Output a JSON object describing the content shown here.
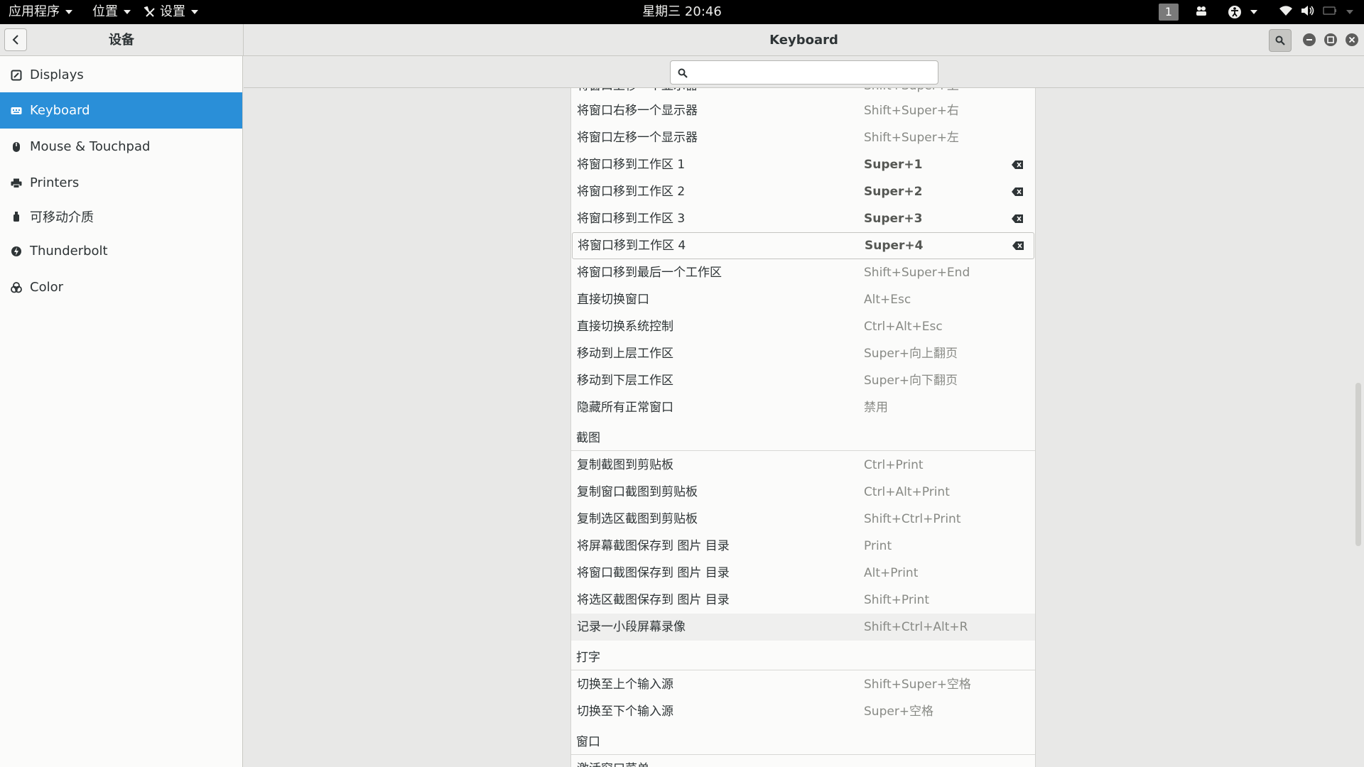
{
  "topbar": {
    "apps_label": "应用程序",
    "places_label": "位置",
    "settings_label": "设置",
    "clock": "星期三 20:46",
    "workspace": "1"
  },
  "header": {
    "sidebar_title": "设备",
    "main_title": "Keyboard"
  },
  "sidebar": {
    "items": [
      {
        "label": "Displays",
        "icon": "display-icon"
      },
      {
        "label": "Keyboard",
        "icon": "keyboard-icon",
        "active": true
      },
      {
        "label": "Mouse & Touchpad",
        "icon": "mouse-icon"
      },
      {
        "label": "Printers",
        "icon": "printer-icon"
      },
      {
        "label": "可移动介质",
        "icon": "removable-media-icon"
      },
      {
        "label": "Thunderbolt",
        "icon": "thunderbolt-icon"
      },
      {
        "label": "Color",
        "icon": "color-icon"
      }
    ]
  },
  "search": {
    "placeholder": "",
    "value": ""
  },
  "shortcuts": {
    "partial_row": {
      "name": "将窗口上移一个显示器",
      "key": "Shift+Super+上"
    },
    "window_rows": [
      {
        "name": "将窗口右移一个显示器",
        "key": "Shift+Super+右"
      },
      {
        "name": "将窗口左移一个显示器",
        "key": "Shift+Super+左"
      },
      {
        "name": "将窗口移到工作区 1",
        "key": "Super+1"
      },
      {
        "name": "将窗口移到工作区 2",
        "key": "Super+2"
      },
      {
        "name": "将窗口移到工作区 3",
        "key": "Super+3"
      },
      {
        "name": "将窗口移到工作区 4",
        "key": "Super+4"
      },
      {
        "name": "将窗口移到最后一个工作区",
        "key": "Shift+Super+End"
      },
      {
        "name": "直接切换窗口",
        "key": "Alt+Esc"
      },
      {
        "name": "直接切换系统控制",
        "key": "Ctrl+Alt+Esc"
      },
      {
        "name": "移动到上层工作区",
        "key": "Super+向上翻页"
      },
      {
        "name": "移动到下层工作区",
        "key": "Super+向下翻页"
      },
      {
        "name": "隐藏所有正常窗口",
        "key": "禁用"
      }
    ],
    "screenshot_section": "截图",
    "screenshot_rows": [
      {
        "name": "复制截图到剪贴板",
        "key": "Ctrl+Print"
      },
      {
        "name": "复制窗口截图到剪贴板",
        "key": "Ctrl+Alt+Print"
      },
      {
        "name": "复制选区截图到剪贴板",
        "key": "Shift+Ctrl+Print"
      },
      {
        "name": "将屏幕截图保存到 图片 目录",
        "key": "Print"
      },
      {
        "name": "将窗口截图保存到 图片 目录",
        "key": "Alt+Print"
      },
      {
        "name": "将选区截图保存到 图片 目录",
        "key": "Shift+Print"
      },
      {
        "name": "记录一小段屏幕录像",
        "key": "Shift+Ctrl+Alt+R"
      }
    ],
    "typing_section": "打字",
    "typing_rows": [
      {
        "name": "切换至上个输入源",
        "key": "Shift+Super+空格"
      },
      {
        "name": "切换至下个输入源",
        "key": "Super+空格"
      }
    ],
    "window_section": "窗口",
    "window_partial_name": "激活窗口菜单"
  }
}
